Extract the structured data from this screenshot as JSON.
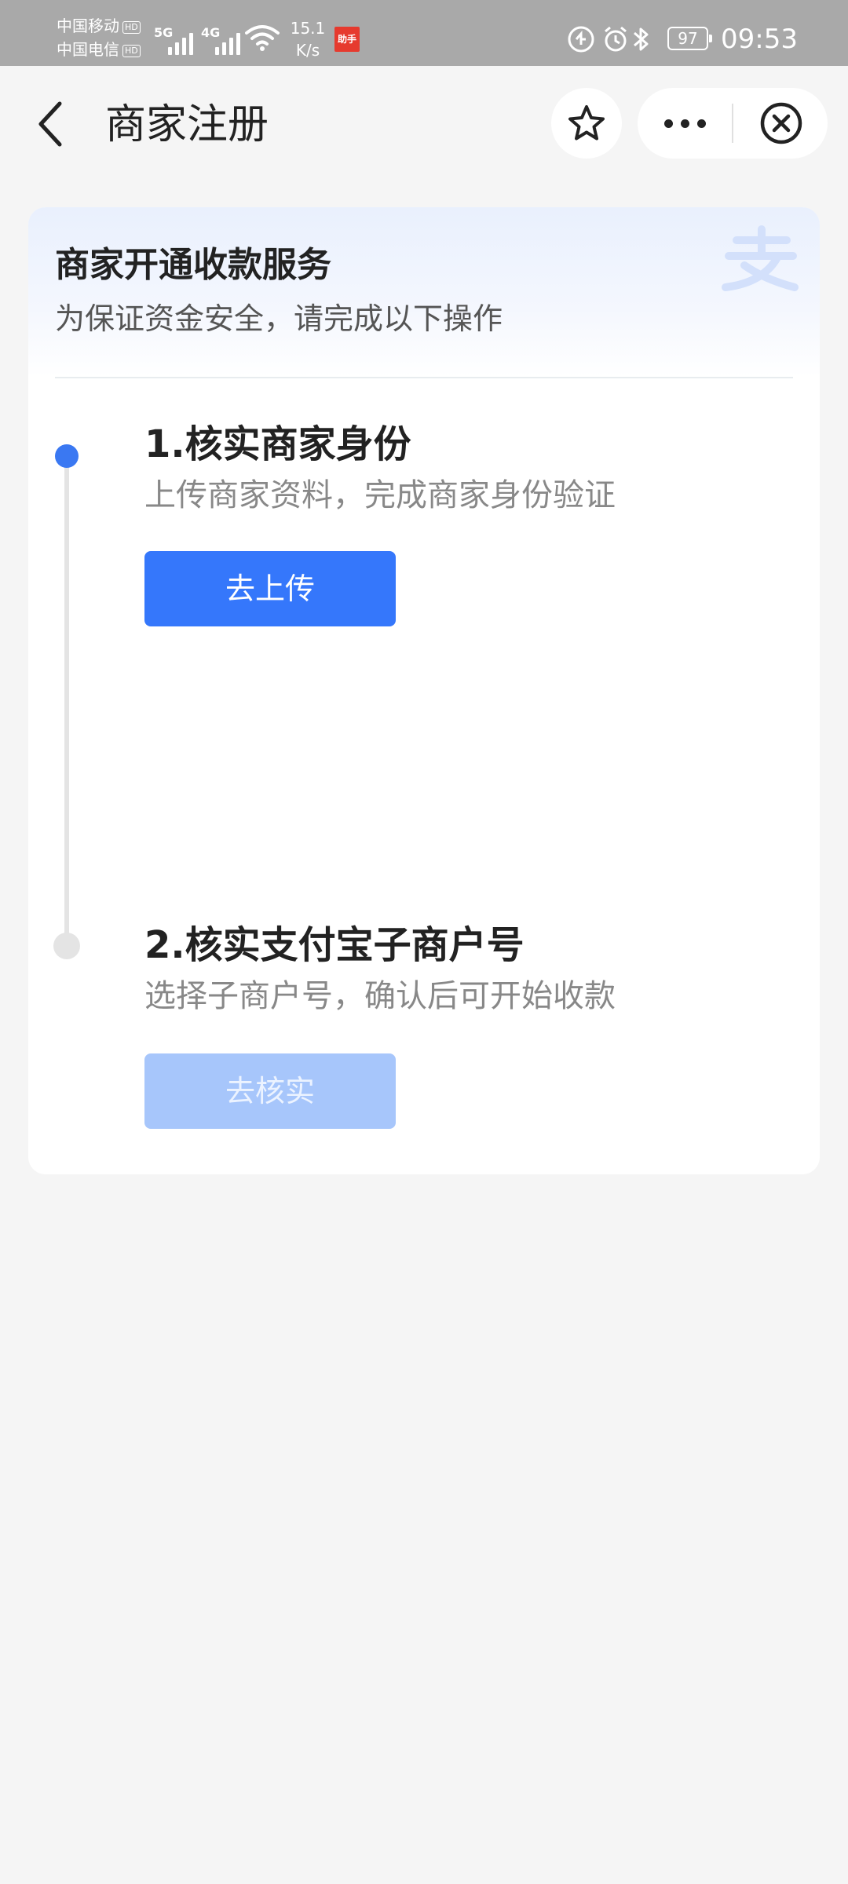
{
  "status_bar": {
    "carrier_1": "中国移动",
    "carrier_2": "中国电信",
    "hd": "HD",
    "net_1": "5G",
    "net_2": "4G",
    "speed_value": "15.1",
    "speed_unit": "K/s",
    "app_badge": "助手",
    "battery": "97",
    "time": "09:53"
  },
  "nav": {
    "title": "商家注册"
  },
  "card": {
    "title": "商家开通收款服务",
    "subtitle": "为保证资金安全，请完成以下操作"
  },
  "steps": [
    {
      "title": "1.核实商家身份",
      "description": "上传商家资料，完成商家身份验证",
      "button": "去上传",
      "state": "active"
    },
    {
      "title": "2.核实支付宝子商户号",
      "description": "选择子商户号，确认后可开始收款",
      "button": "去核实",
      "state": "disabled"
    }
  ],
  "colors": {
    "primary": "#3577fb",
    "disabled": "#a7c6fb",
    "status_bar_bg": "#a9a9a9",
    "page_bg": "#f5f5f5"
  }
}
